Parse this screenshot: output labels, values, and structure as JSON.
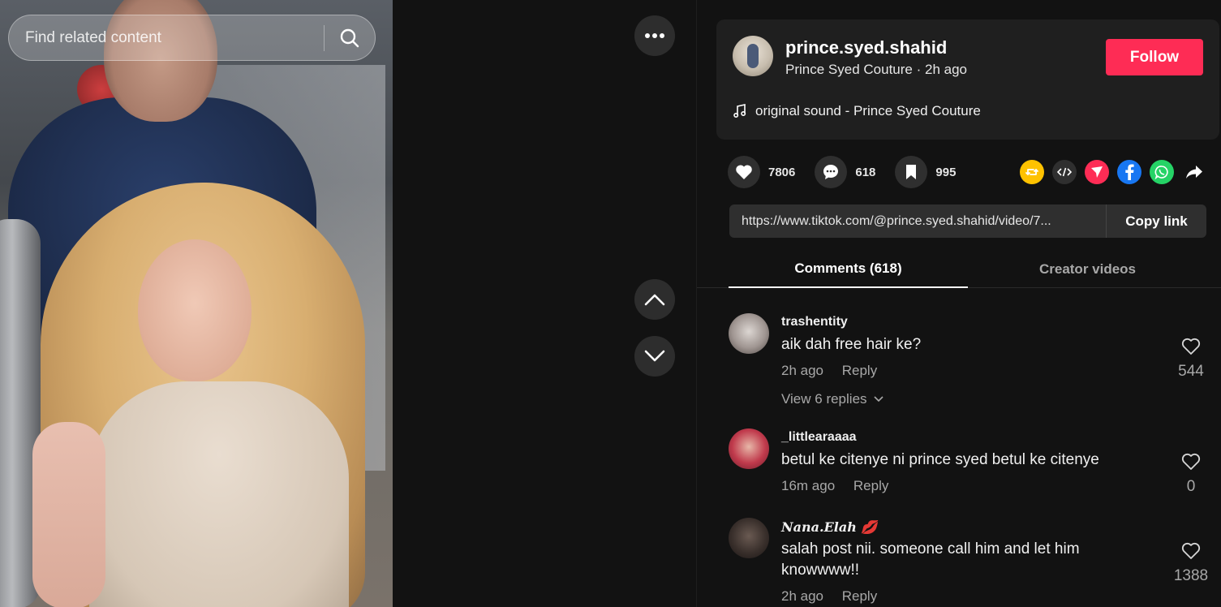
{
  "search": {
    "placeholder": "Find related content"
  },
  "author": {
    "username": "prince.syed.shahid",
    "display_name": "Prince Syed Couture",
    "separator": "·",
    "time": "2h ago",
    "follow_label": "Follow"
  },
  "sound": {
    "title": "original sound - Prince Syed Couture"
  },
  "actions": {
    "likes": "7806",
    "comments": "618",
    "saves": "995"
  },
  "share_icons": [
    "repost-icon",
    "embed-icon",
    "send-icon",
    "facebook-icon",
    "whatsapp-icon",
    "share-arrow-icon"
  ],
  "link": {
    "url": "https://www.tiktok.com/@prince.syed.shahid/video/7...",
    "copy_label": "Copy link"
  },
  "tabs": {
    "comments": "Comments (618)",
    "creator": "Creator videos"
  },
  "comments": [
    {
      "user": "trashentity",
      "text": "aik dah free hair ke?",
      "time": "2h ago",
      "reply": "Reply",
      "likes": "544",
      "replies": "View 6 replies"
    },
    {
      "user": "_littlearaaaa",
      "text": "betul ke citenye ni prince syed betul ke citenye",
      "time": "16m ago",
      "reply": "Reply",
      "likes": "0"
    },
    {
      "user": "𝑵𝒂𝒏𝒂.𝑬𝒍𝒂𝒉 💋",
      "text": "salah post nii. someone call him and let him knowwww!!",
      "time": "2h ago",
      "reply": "Reply",
      "likes": "1388"
    }
  ],
  "colors": {
    "follow": "#fe2c55",
    "background": "#121212",
    "card": "#1f1f1f",
    "repost": "#ffc200",
    "send": "#fe2c55",
    "facebook": "#1877f2",
    "whatsapp": "#25d366"
  }
}
